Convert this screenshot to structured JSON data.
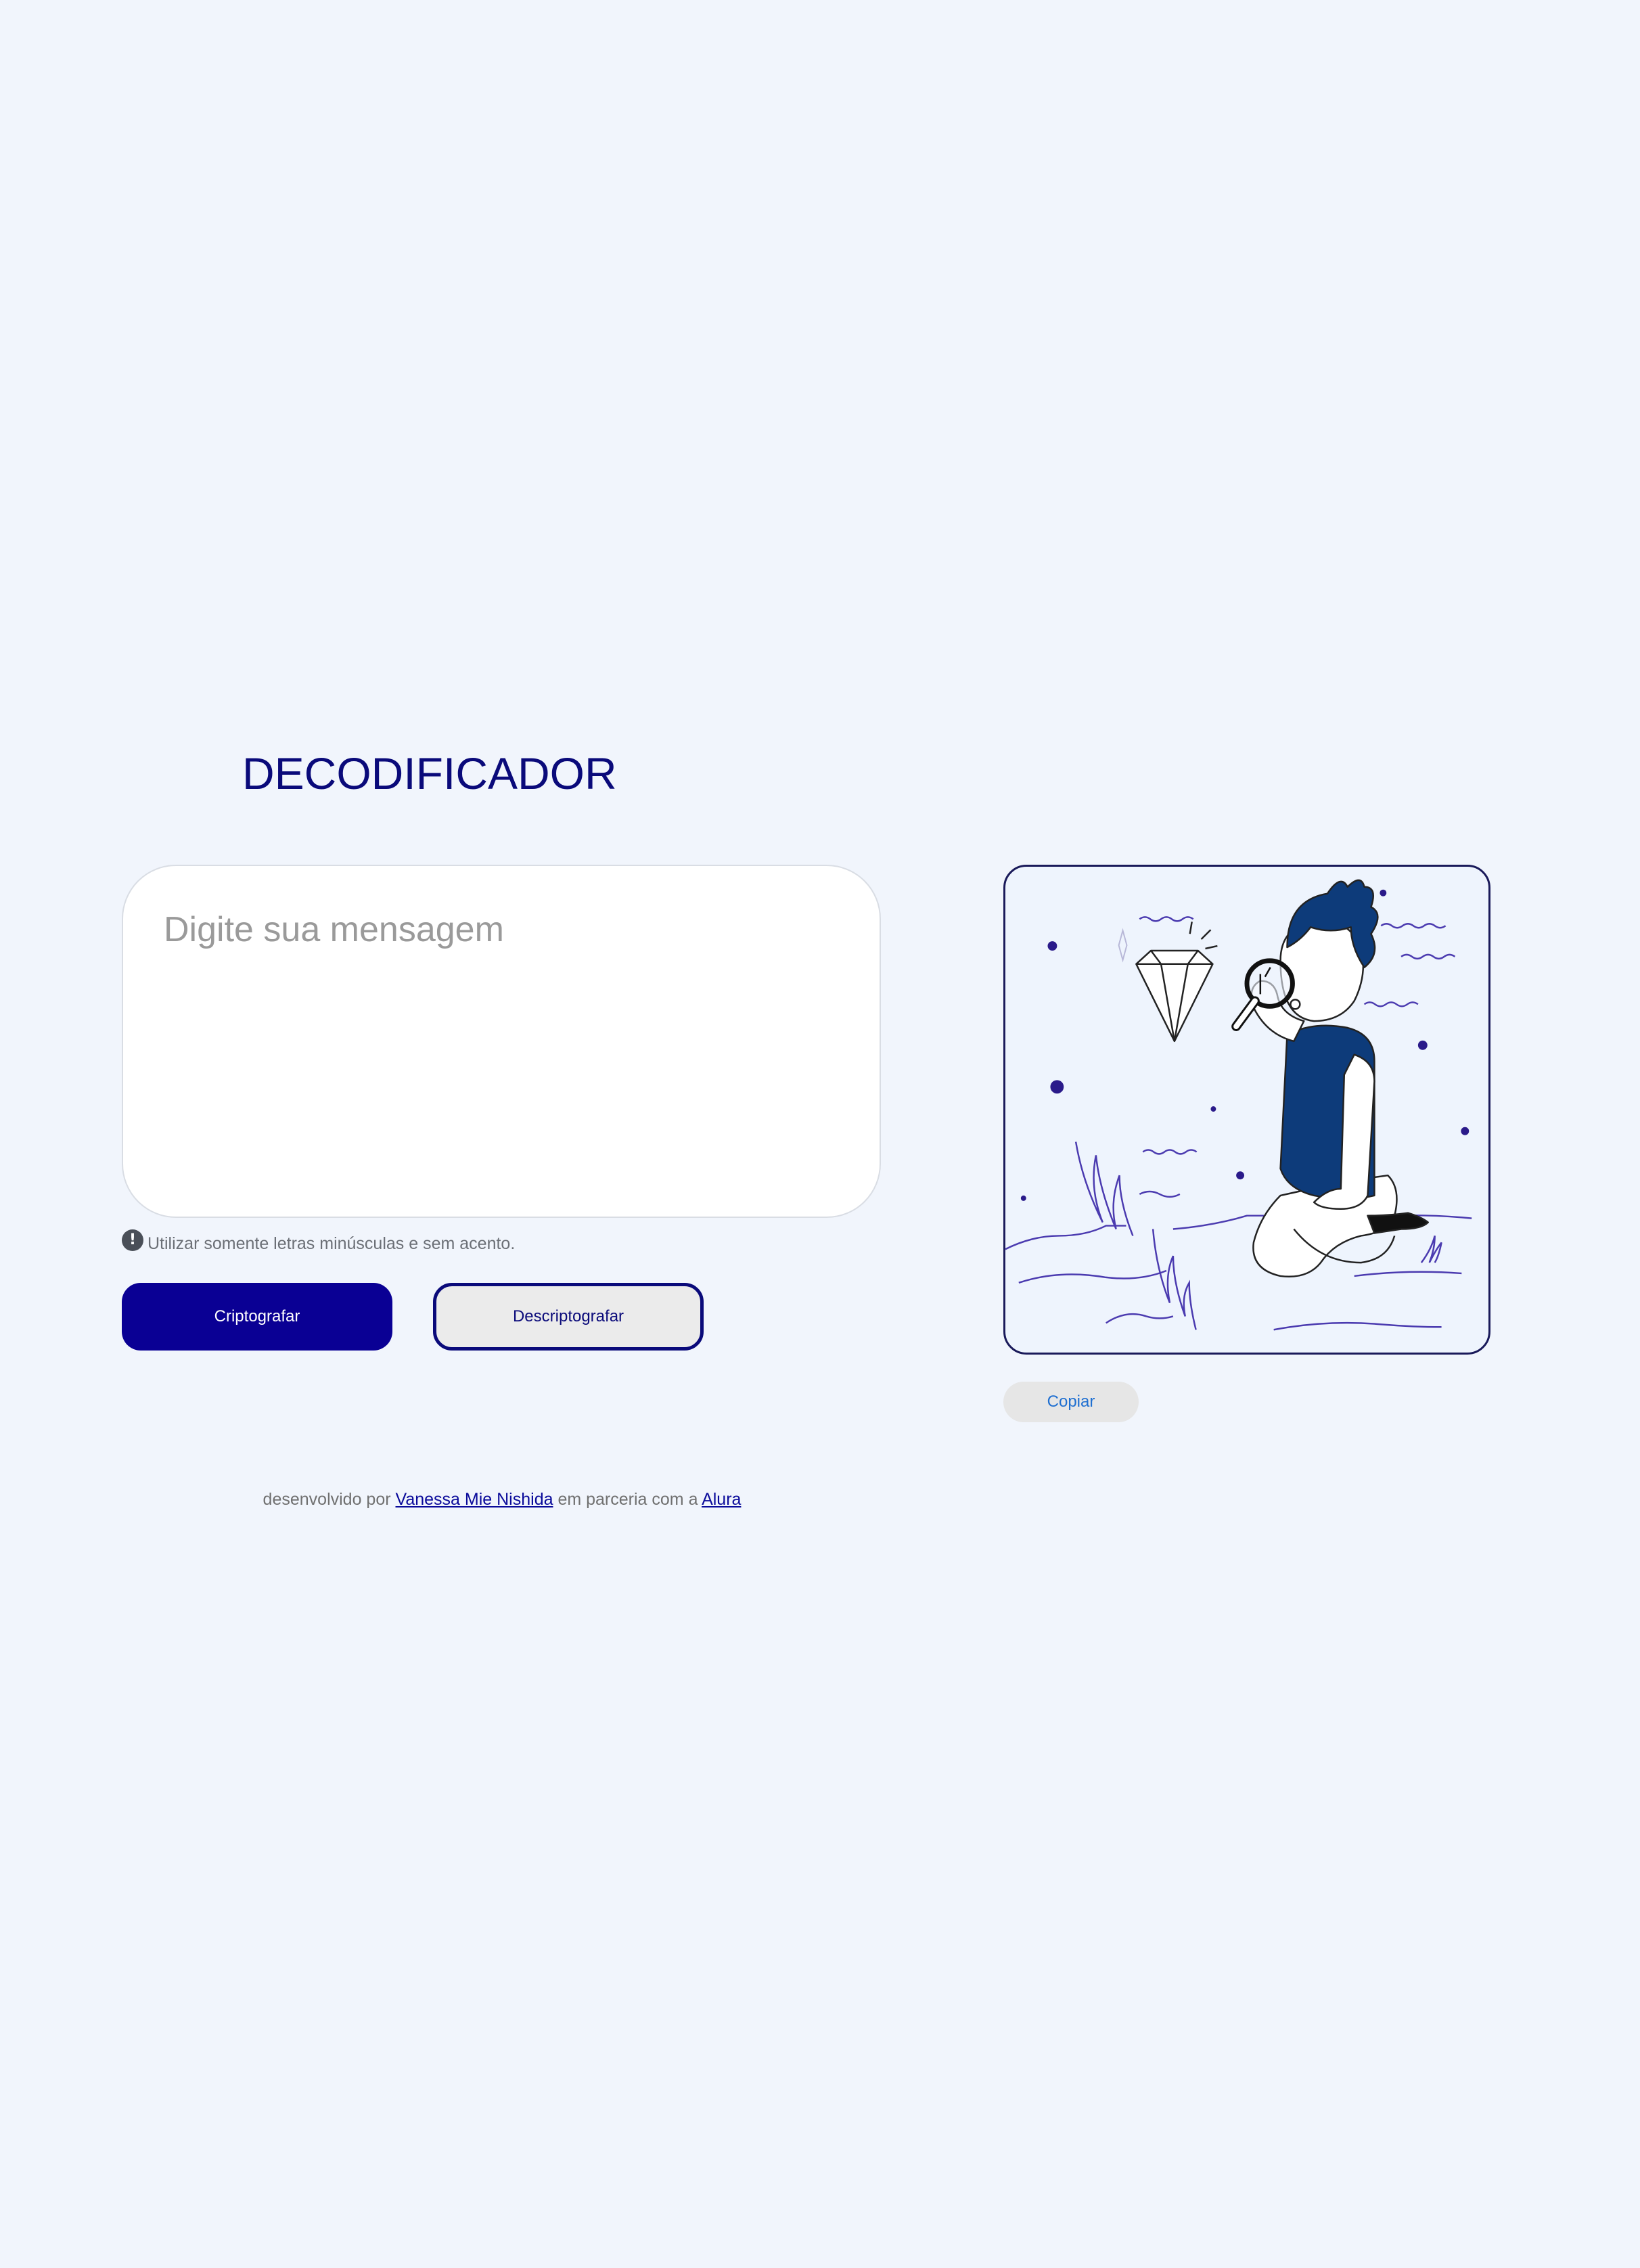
{
  "header": {
    "title": "DECODIFICADOR"
  },
  "input": {
    "placeholder": "Digite sua mensagem",
    "value": ""
  },
  "hint": {
    "icon": "exclamation-icon",
    "text": "Utilizar somente letras minúsculas e sem acento."
  },
  "actions": {
    "encrypt_label": "Criptografar",
    "decrypt_label": "Descriptografar"
  },
  "output": {
    "illustration": "person-with-magnifying-glass-and-diamond-illustration",
    "copy_label": "Copiar"
  },
  "footer": {
    "prefix": "desenvolvido por",
    "author_link": "Vanessa Mie Nishida",
    "middle": "em parceria com a",
    "partner_link": "Alura"
  },
  "colors": {
    "background": "#f1f5fc",
    "accent": "#0a0094",
    "title": "#0a0a7a",
    "link": "#1f6fd1"
  }
}
